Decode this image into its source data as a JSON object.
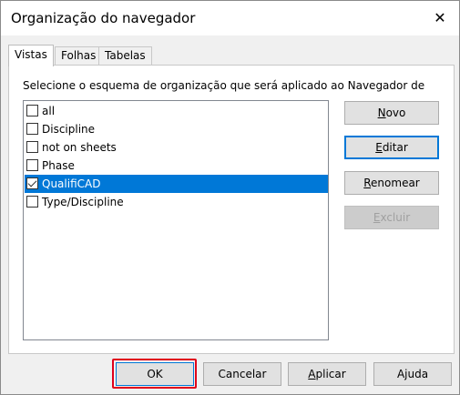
{
  "window": {
    "title": "Organização do navegador",
    "close_symbol": "✕"
  },
  "tabs": [
    {
      "label": "Vistas",
      "active": true
    },
    {
      "label": "Folhas",
      "active": false
    },
    {
      "label": "Tabelas",
      "active": false
    }
  ],
  "panel": {
    "instruction": "Selecione o esquema de organização que será aplicado ao Navegador de",
    "items": [
      {
        "label": "all",
        "checked": false,
        "selected": false
      },
      {
        "label": "Discipline",
        "checked": false,
        "selected": false
      },
      {
        "label": "not on sheets",
        "checked": false,
        "selected": false
      },
      {
        "label": "Phase",
        "checked": false,
        "selected": false
      },
      {
        "label": "QualifiCAD",
        "checked": true,
        "selected": true
      },
      {
        "label": "Type/Discipline",
        "checked": false,
        "selected": false
      }
    ],
    "side_buttons": {
      "new": {
        "mn": "N",
        "rest": "ovo"
      },
      "edit": {
        "mn": "E",
        "rest": "ditar"
      },
      "rename": {
        "mn": "R",
        "rest": "enomear"
      },
      "delete": {
        "mn": "E",
        "rest": "xcluir"
      }
    }
  },
  "footer": {
    "ok": "OK",
    "cancel": "Cancelar",
    "apply": {
      "mn": "A",
      "rest": "plicar"
    },
    "help": "Ajuda"
  },
  "colors": {
    "selection": "#0078d7",
    "highlight_box": "#e0001b"
  }
}
